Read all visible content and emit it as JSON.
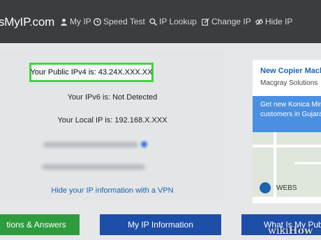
{
  "navbar": {
    "brand": "sMyIP.com",
    "items": [
      {
        "label": "My IP",
        "icon": "user-icon"
      },
      {
        "label": "Speed Test",
        "icon": "clock-icon"
      },
      {
        "label": "IP Lookup",
        "icon": "search-icon"
      },
      {
        "label": "Change IP",
        "icon": "edit-icon"
      },
      {
        "label": "Hide IP",
        "icon": "eye-slash-icon"
      }
    ]
  },
  "ip_info": {
    "ipv4": "Your Public IPv4 is: 43.24X.XXX.XX",
    "ipv6": "Your IPv6 is: Not Detected",
    "local": "Your Local IP is: 192.168.X.XXX",
    "vpn_link": "Hide your IP information with a VPN"
  },
  "ad": {
    "title": "New Copier Mach",
    "company": "Macgray Solutions",
    "banner_line1": "Get new Konica Min",
    "banner_line2": "customers in Gujara",
    "web_label": "WEBS"
  },
  "buttons": {
    "answers": "tions & Answers",
    "my_ip_info": "My IP Information",
    "what_is": "What Is My Publi"
  },
  "watermark": {
    "wiki": "wiki",
    "how": "How"
  },
  "colors": {
    "navbar": "#3b3d41",
    "highlight": "#3fd63f",
    "link": "#1a63b0",
    "green_button": "#2e9c3e",
    "blue_button": "#1e4fa8"
  }
}
